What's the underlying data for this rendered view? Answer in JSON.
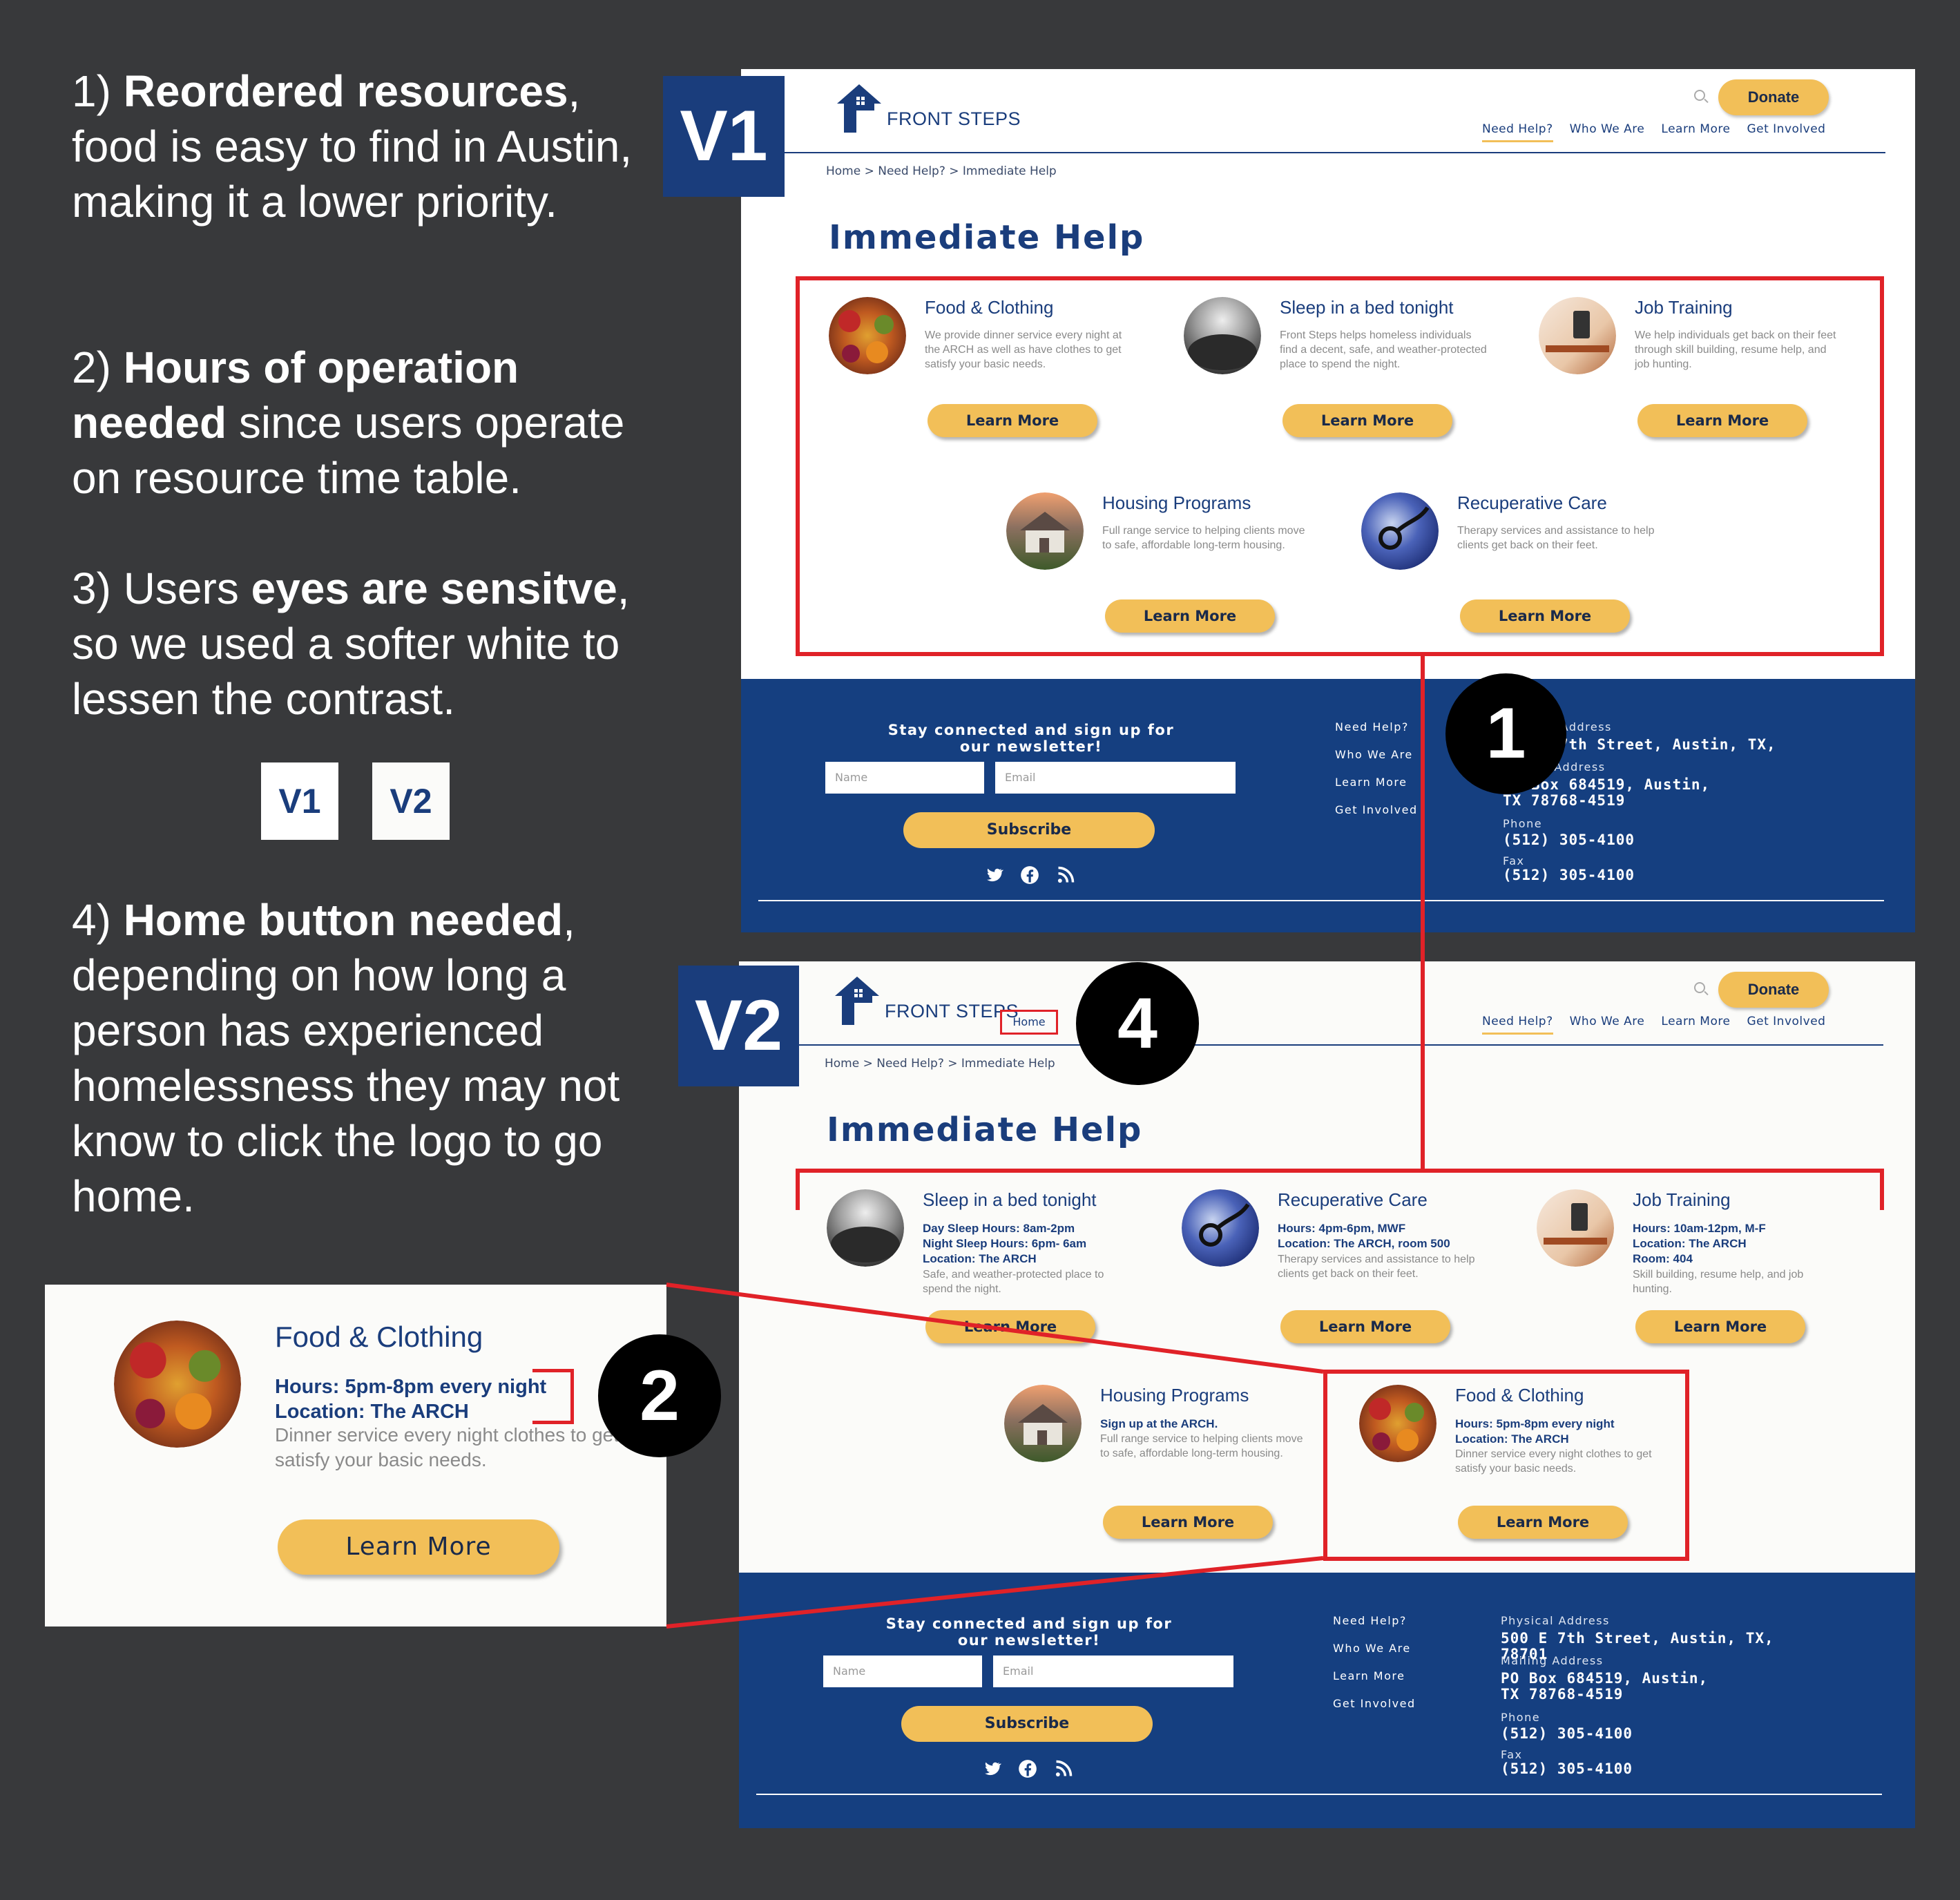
{
  "notes": {
    "n1_num": "1)",
    "n1_bold": "Reordered resources",
    "n1_rest": ", food is easy to find in Austin, making it a lower priority.",
    "n2_num": "2)",
    "n2_bold": "Hours of operation needed",
    "n2_rest": " since users operate on resource time table.",
    "n3_pre": "3) Users ",
    "n3_bold": "eyes are sensitve",
    "n3_rest": ", so we used a softer white to lessen the contrast.",
    "n4_num": "4)",
    "n4_bold": "Home button needed",
    "n4_rest": ", depending on how long a person has experienced homelessness they may not know to click the logo to go home.",
    "swatch_v1": "V1",
    "swatch_v2": "V2"
  },
  "tags": {
    "v1": "V1",
    "v2": "V2"
  },
  "badges": {
    "b1": "1",
    "b2": "2",
    "b4": "4"
  },
  "header": {
    "logo_text": "FRONT STEPS",
    "home_button": "Home",
    "donate": "Donate",
    "nav": [
      "Need Help?",
      "Who We Are",
      "Learn More",
      "Get Involved"
    ]
  },
  "breadcrumb": "Home > Need Help? > Immediate Help",
  "page_title": "Immediate Help",
  "learn_more": "Learn More",
  "v1_cards": [
    {
      "title": "Food & Clothing",
      "desc": "We provide dinner service every night at the ARCH as well as have clothes to get satisfy your basic needs."
    },
    {
      "title": "Sleep in a bed tonight",
      "desc": "Front Steps helps homeless individuals find a decent, safe, and weather-protected place to spend the night."
    },
    {
      "title": "Job Training",
      "desc": "We help individuals get back on their feet through skill building, resume help, and job hunting."
    },
    {
      "title": "Housing Programs",
      "desc": "Full range service to helping clients move to safe, affordable long-term housing."
    },
    {
      "title": "Recuperative Care",
      "desc": "Therapy services and assistance to help clients get back on their feet."
    }
  ],
  "v2_cards": [
    {
      "title": "Sleep in a bed tonight",
      "hours": "Day Sleep Hours: 8am-2pm\nNight Sleep Hours: 6pm- 6am\nLocation: The ARCH",
      "desc": "Safe, and weather-protected place to spend the night."
    },
    {
      "title": "Recuperative Care",
      "hours": "Hours: 4pm-6pm, MWF\nLocation: The ARCH, room 500",
      "desc": "Therapy services and assistance to help clients get back on their feet."
    },
    {
      "title": "Job Training",
      "hours": "Hours: 10am-12pm, M-F\nLocation: The ARCH\nRoom: 404",
      "desc": "Skill building, resume help, and job hunting."
    },
    {
      "title": "Housing Programs",
      "hours": "Sign up at the ARCH.",
      "desc": "Full range service to helping clients move to safe, affordable long-term housing."
    },
    {
      "title": "Food & Clothing",
      "hours": "Hours: 5pm-8pm every night\nLocation: The ARCH",
      "desc": "Dinner service every night clothes to get satisfy your basic needs."
    }
  ],
  "zoom_card": {
    "title": "Food & Clothing",
    "hours": "Hours: 5pm-8pm every night",
    "location": "Location: The ARCH",
    "desc": "Dinner service every night clothes to get satisfy your basic needs."
  },
  "footer": {
    "newsletter": "Stay connected and sign up for our newsletter!",
    "name_ph": "Name",
    "email_ph": "Email",
    "subscribe": "Subscribe",
    "links": [
      "Need Help?",
      "Who We Are",
      "Learn More",
      "Get Involved"
    ],
    "physical_label": "Physical Address",
    "physical": "500 E 7th Street, Austin, TX, 78701",
    "mailing_label": "Mailing Address",
    "mailing": "PO Box 684519, Austin, TX 78768-4519",
    "phone_label": "Phone",
    "phone": "(512) 305-4100",
    "fax_label": "Fax",
    "fax": "(512) 305-4100",
    "social_icons": [
      "twitter-icon",
      "facebook-icon",
      "rss-icon"
    ]
  },
  "colors": {
    "navy": "#153f80",
    "accent": "#f2bf58",
    "annotation_red": "#e02228",
    "background": "#38393b"
  }
}
